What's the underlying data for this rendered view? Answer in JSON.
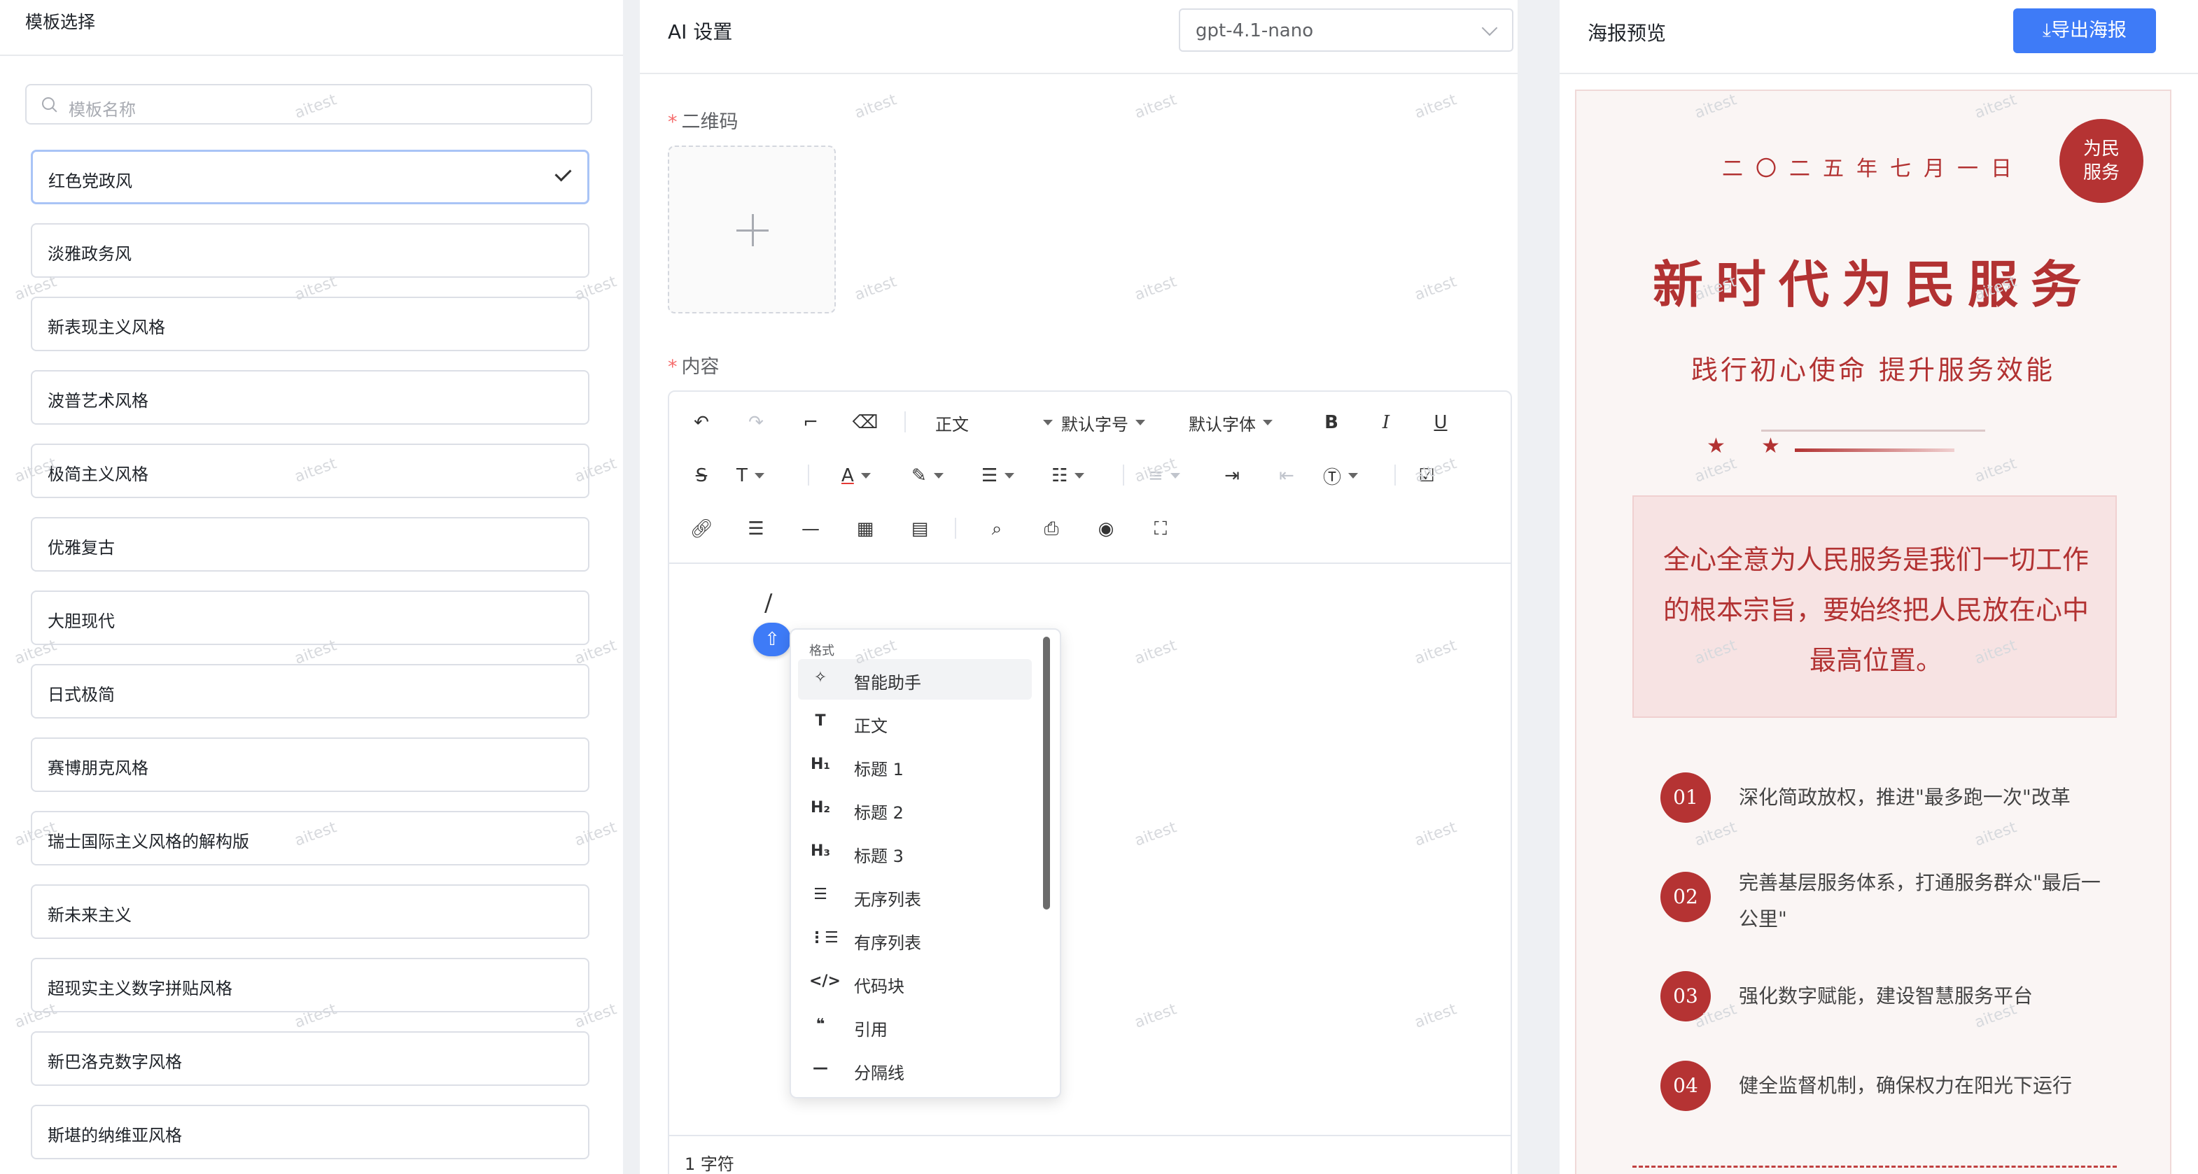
{
  "templates": {
    "header": "模板选择",
    "search_placeholder": "模板名称",
    "items": [
      {
        "label": "红色党政风",
        "selected": true
      },
      {
        "label": "淡雅政务风"
      },
      {
        "label": "新表现主义风格"
      },
      {
        "label": "波普艺术风格"
      },
      {
        "label": "极简主义风格"
      },
      {
        "label": "优雅复古"
      },
      {
        "label": "大胆现代"
      },
      {
        "label": "日式极简"
      },
      {
        "label": "赛博朋克风格"
      },
      {
        "label": "瑞士国际主义风格的解构版"
      },
      {
        "label": "新未来主义"
      },
      {
        "label": "超现实主义数字拼贴风格"
      },
      {
        "label": "新巴洛克数字风格"
      },
      {
        "label": "斯堪的纳维亚风格"
      }
    ]
  },
  "ai_settings": {
    "title": "AI 设置",
    "model": "gpt-4.1-nano",
    "qr_label": "二维码",
    "content_label": "内容",
    "required_mark": "*"
  },
  "toolbar": {
    "paragraph": "正文",
    "font_size": "默认字号",
    "font_family": "默认字体",
    "bold": "B",
    "italic": "I",
    "underline": "U",
    "strike": "S",
    "text_t": "T",
    "font_color": "A"
  },
  "editor": {
    "cursor_char": "/",
    "char_count": "1 字符"
  },
  "slash_menu": {
    "header": "格式",
    "items": [
      {
        "icon": "✧",
        "label": "智能助手",
        "active": true
      },
      {
        "icon": "T",
        "label": "正文"
      },
      {
        "icon": "H₁",
        "label": "标题 1"
      },
      {
        "icon": "H₂",
        "label": "标题 2"
      },
      {
        "icon": "H₃",
        "label": "标题 3"
      },
      {
        "icon": "☰",
        "label": "无序列表"
      },
      {
        "icon": "⋮☰",
        "label": "有序列表"
      },
      {
        "icon": "</>",
        "label": "代码块"
      },
      {
        "icon": "❝",
        "label": "引用"
      },
      {
        "icon": "—",
        "label": "分隔线"
      }
    ]
  },
  "preview": {
    "header": "海报预览",
    "export_label": "⤓导出海报",
    "poster": {
      "date": "二〇二五年七月一日",
      "badge": "为民\n服务",
      "badge_line1": "为民",
      "badge_line2": "服务",
      "title": "新时代为民服务",
      "subtitle": "践行初心使命 提升服务效能",
      "star": "★",
      "quote": "全心全意为人民服务是我们一切工作的根本宗旨，要始终把人民放在心中最高位置。",
      "points": [
        {
          "num": "01",
          "text": "深化简政放权，推进\"最多跑一次\"改革"
        },
        {
          "num": "02",
          "text": "完善基层服务体系，打通服务群众\"最后一公里\""
        },
        {
          "num": "03",
          "text": "强化数字赋能，建设智慧服务平台"
        },
        {
          "num": "04",
          "text": "健全监督机制，确保权力在阳光下运行"
        }
      ]
    }
  },
  "watermark": "aitest",
  "colors": {
    "primary": "#3e7bf7",
    "poster_red": "#b23232",
    "selected_border": "#a9c4f6"
  }
}
